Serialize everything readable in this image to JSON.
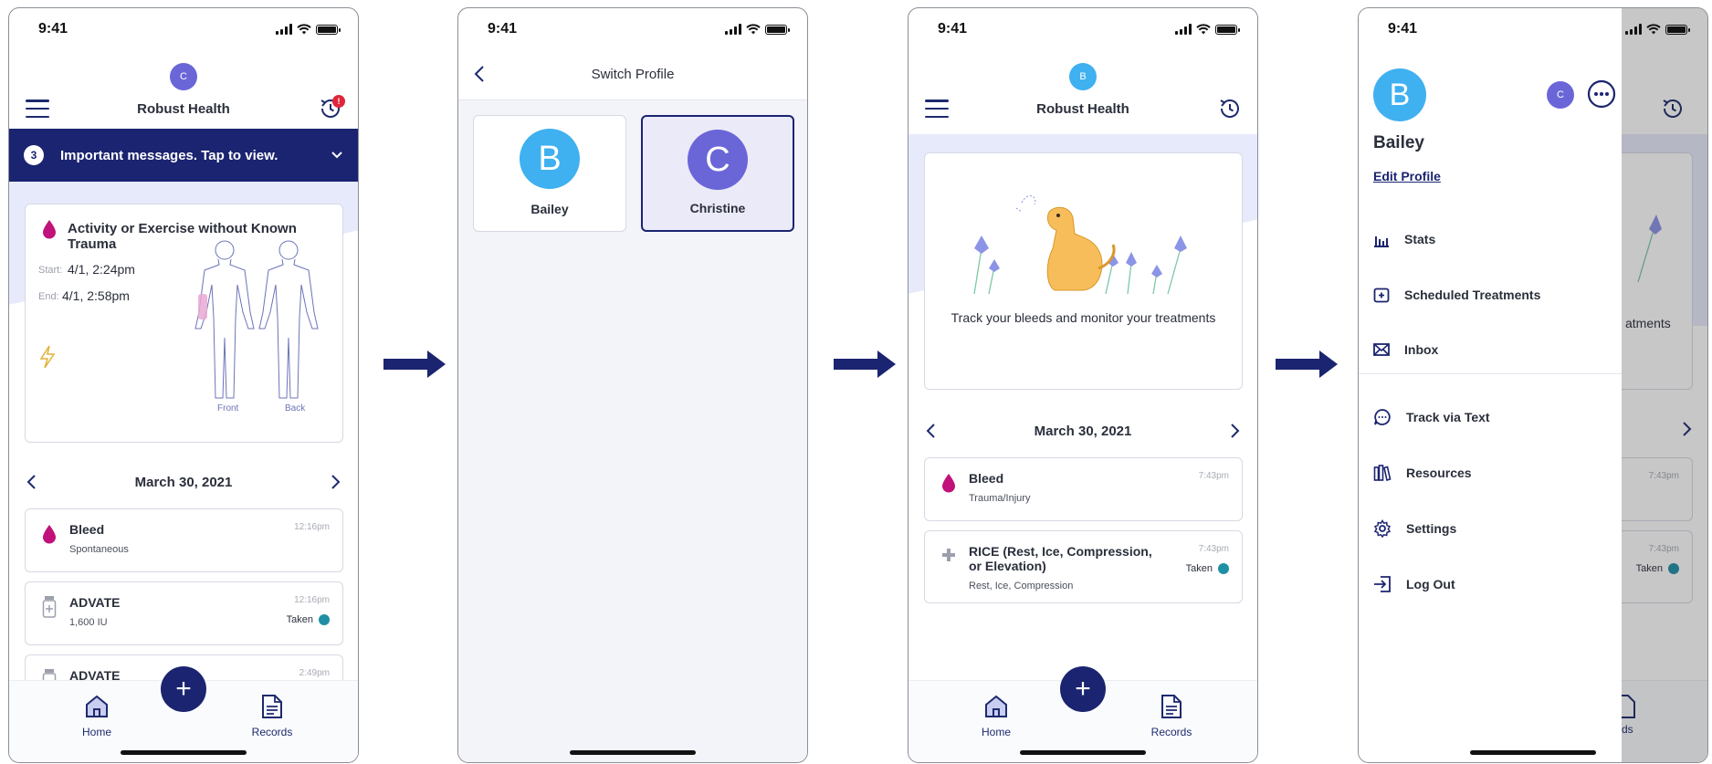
{
  "status_time": "9:41",
  "app_title": "Robust Health",
  "notification_count": "!",
  "screen1": {
    "header_avatar_initial": "C",
    "banner": {
      "count": "3",
      "text": "Important messages. Tap to view."
    },
    "episode": {
      "title": "Activity or Exercise without Known Trauma",
      "start_label": "Start:",
      "start_value": "4/1, 2:24pm",
      "end_label": "End:",
      "end_value": "4/1, 2:58pm",
      "front_label": "Front",
      "back_label": "Back"
    },
    "date": "March 30, 2021",
    "logs": [
      {
        "title": "Bleed",
        "subtitle": "Spontaneous",
        "time": "12:16pm",
        "status": ""
      },
      {
        "title": "ADVATE",
        "subtitle": "1,600 IU",
        "time": "12:16pm",
        "status": "Taken"
      },
      {
        "title": "ADVATE",
        "subtitle": "",
        "time": "2:49pm",
        "status": ""
      }
    ]
  },
  "screen2": {
    "title": "Switch Profile",
    "profiles": [
      {
        "initial": "B",
        "name": "Bailey",
        "selected": false
      },
      {
        "initial": "C",
        "name": "Christine",
        "selected": true
      }
    ]
  },
  "screen3": {
    "header_avatar_initial": "B",
    "welcome_text": "Track your bleeds and monitor your treatments",
    "date": "March 30, 2021",
    "logs": [
      {
        "title": "Bleed",
        "subtitle": "Trauma/Injury",
        "time": "7:43pm",
        "status": ""
      },
      {
        "title": "RICE (Rest, Ice, Compression, or Elevation)",
        "subtitle": "Rest, Ice, Compression",
        "time": "7:43pm",
        "status": "Taken"
      }
    ]
  },
  "screen4": {
    "avatar_initial": "B",
    "other_avatar_initial": "C",
    "name": "Bailey",
    "edit_profile": "Edit Profile",
    "menu": [
      {
        "label": "Stats",
        "icon": "bar-chart-icon"
      },
      {
        "label": "Scheduled Treatments",
        "icon": "calendar-plus-icon"
      },
      {
        "label": "Inbox",
        "icon": "envelope-icon"
      },
      {
        "label": "Track via Text",
        "icon": "chat-bubble-icon"
      },
      {
        "label": "Resources",
        "icon": "books-icon"
      },
      {
        "label": "Settings",
        "icon": "gear-icon"
      },
      {
        "label": "Log Out",
        "icon": "logout-icon"
      }
    ],
    "ghost_text": "atments",
    "ghost_time": "7:43pm",
    "ghost_taken": "Taken",
    "ghost_tab": "rds"
  },
  "tabs": {
    "home": "Home",
    "records": "Records",
    "add": "+"
  },
  "colors": {
    "navy": "#1b2470",
    "accent_blue": "#3fb0f0",
    "accent_purple": "#6a66d8",
    "bleed_red": "#c0127a",
    "taken_teal": "#1f8fa6",
    "alert_red": "#e0263a"
  }
}
